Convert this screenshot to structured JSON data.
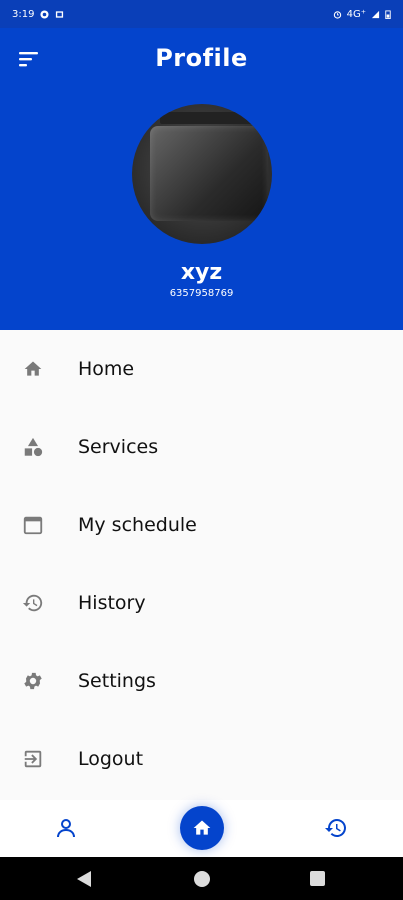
{
  "status_bar": {
    "time": "3:19",
    "network": "4G⁺",
    "icons": [
      "vpn-icon",
      "sim-icon",
      "alarm-icon",
      "signal-icon",
      "battery-icon"
    ]
  },
  "header": {
    "title": "Profile",
    "menu_icon": "sort-menu-icon"
  },
  "user": {
    "name": "xyz",
    "phone": "6357958769"
  },
  "menu": {
    "items": [
      {
        "label": "Home",
        "icon": "home-icon"
      },
      {
        "label": "Services",
        "icon": "category-shapes-icon"
      },
      {
        "label": "My schedule",
        "icon": "calendar-icon"
      },
      {
        "label": "History",
        "icon": "history-icon"
      },
      {
        "label": "Settings",
        "icon": "gear-icon"
      },
      {
        "label": "Logout",
        "icon": "logout-icon"
      }
    ]
  },
  "bottom_nav": {
    "items": [
      "person-icon",
      "home-icon",
      "history-icon"
    ],
    "active": "home"
  },
  "colors": {
    "primary": "#0444cc",
    "status_bar": "#0a3fb8",
    "menu_icon": "#7a7a7a",
    "text": "#111111",
    "background": "#fafafa"
  }
}
